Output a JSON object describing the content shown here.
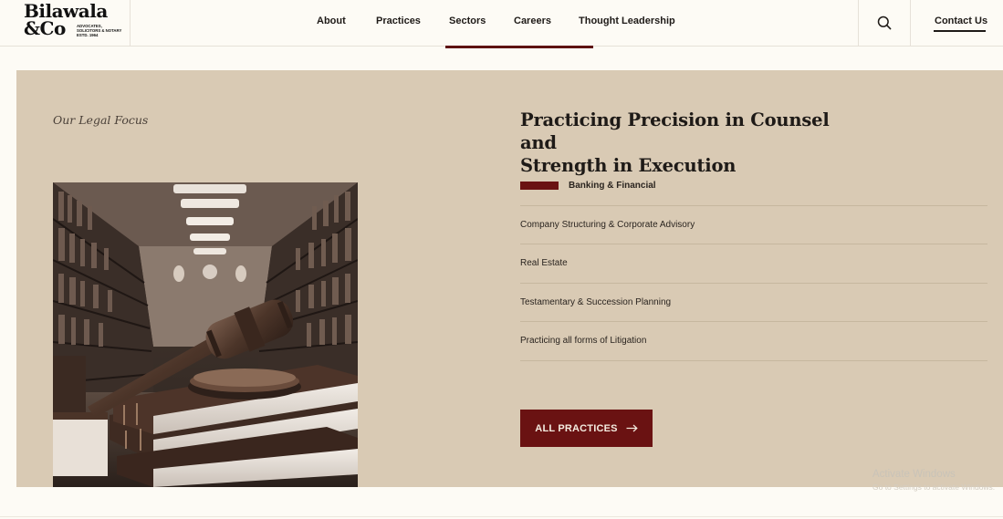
{
  "header": {
    "logo": {
      "name_line1": "Bilawala",
      "name_line2": "&Co",
      "tagline_line1": "ADVOCATES,",
      "tagline_line2": "SOLICITORS & NOTARY",
      "tagline_line3": "ESTD. 1964"
    },
    "nav": [
      {
        "label": "About"
      },
      {
        "label": "Practices"
      },
      {
        "label": "Sectors"
      },
      {
        "label": "Careers"
      },
      {
        "label": "Thought Leadership"
      }
    ],
    "active_nav": "Sectors",
    "search_icon": "search-icon",
    "contact_label": "Contact Us"
  },
  "main": {
    "section_label": "Our Legal Focus",
    "headline_line1": "Practicing Precision in Counsel and",
    "headline_line2": "Strength in Execution",
    "practices": [
      {
        "label": "Banking & Financial",
        "active": true
      },
      {
        "label": "Company Structuring & Corporate Advisory",
        "active": false
      },
      {
        "label": "Real Estate",
        "active": false
      },
      {
        "label": "Testamentary & Succession Planning",
        "active": false
      },
      {
        "label": "Practicing all forms of Litigation",
        "active": false
      }
    ],
    "button_label": "ALL PRACTICES",
    "button_icon": "arrow-right-icon",
    "image_subject": "gavel-on-books-library-photo"
  },
  "watermark": {
    "title": "Activate Windows",
    "subtitle": "Go to Settings to activate Windows."
  },
  "colors": {
    "page_bg": "#fdfbf5",
    "panel_bg": "#d9cab4",
    "accent": "#6a1212",
    "text": "#1e1a17"
  }
}
